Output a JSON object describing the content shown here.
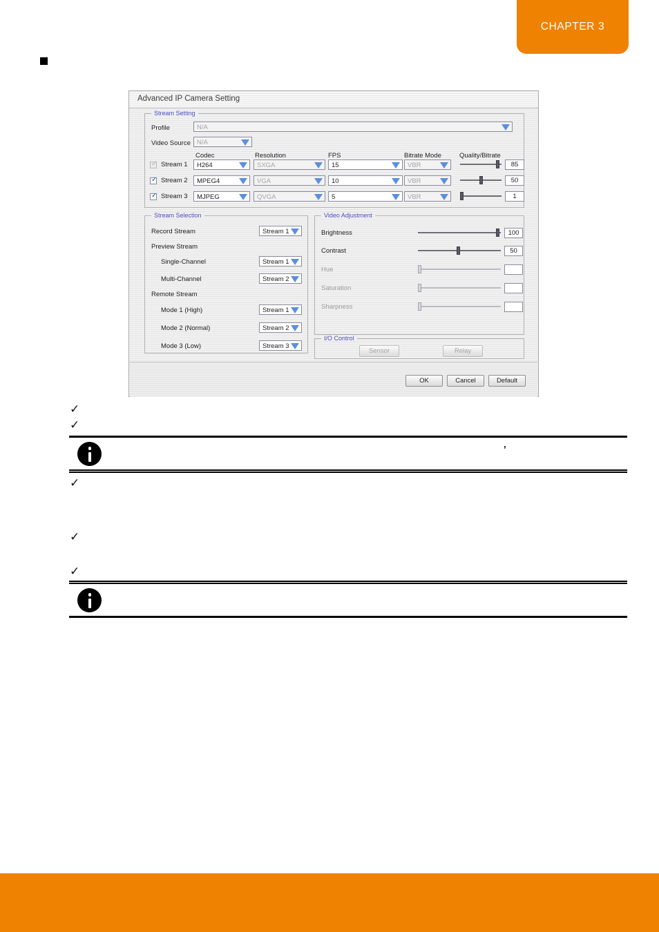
{
  "page": {
    "chapter_label": "CHAPTER 3",
    "accent_color": "#ef8200",
    "stray_comma": ","
  },
  "dialog": {
    "title": "Advanced IP Camera Setting",
    "stream_setting": {
      "legend": "Stream Setting",
      "profile_label": "Profile",
      "profile_value": "N/A",
      "video_source_label": "Video Source",
      "video_source_value": "N/A",
      "columns": {
        "codec": "Codec",
        "resolution": "Resolution",
        "fps": "FPS",
        "bitrate_mode": "Bitrate Mode",
        "quality_bitrate": "Quality/Bitrate"
      },
      "rows": [
        {
          "label": "Stream 1",
          "enabled": "checked-disabled",
          "codec": "H264",
          "resolution": "SXGA",
          "fps": "15",
          "bitrate_mode": "VBR",
          "quality": "85"
        },
        {
          "label": "Stream 2",
          "enabled": "checked",
          "codec": "MPEG4",
          "resolution": "VGA",
          "fps": "10",
          "bitrate_mode": "VBR",
          "quality": "50"
        },
        {
          "label": "Stream 3",
          "enabled": "checked",
          "codec": "MJPEG",
          "resolution": "QVGA",
          "fps": "5",
          "bitrate_mode": "VBR",
          "quality": "1"
        }
      ]
    },
    "stream_selection": {
      "legend": "Stream Selection",
      "record_stream_label": "Record Stream",
      "record_stream_value": "Stream 1",
      "preview_stream_label": "Preview Stream",
      "single_channel_label": "Single-Channel",
      "single_channel_value": "Stream 1",
      "multi_channel_label": "Multi-Channel",
      "multi_channel_value": "Stream 2",
      "remote_stream_label": "Remote Stream",
      "mode1_label": "Mode 1 (High)",
      "mode1_value": "Stream 1",
      "mode2_label": "Mode 2 (Normal)",
      "mode2_value": "Stream 2",
      "mode3_label": "Mode 3 (Low)",
      "mode3_value": "Stream 3"
    },
    "video_adjustment": {
      "legend": "Video Adjustment",
      "items": [
        {
          "label": "Brightness",
          "value": "100",
          "enabled": true
        },
        {
          "label": "Contrast",
          "value": "50",
          "enabled": true
        },
        {
          "label": "Hue",
          "value": "",
          "enabled": false
        },
        {
          "label": "Saturation",
          "value": "",
          "enabled": false
        },
        {
          "label": "Sharpness",
          "value": "",
          "enabled": false
        }
      ]
    },
    "io_control": {
      "legend": "I/O Control",
      "sensor_label": "Sensor",
      "relay_label": "Relay"
    },
    "buttons": {
      "ok": "OK",
      "cancel": "Cancel",
      "default": "Default"
    }
  },
  "body_markers": {
    "check_glyph": "✓",
    "bullets": [
      "",
      "",
      "",
      "",
      ""
    ],
    "notes": [
      {
        "icon": "info-icon",
        "text": ""
      },
      {
        "icon": "info-icon",
        "text": ""
      }
    ]
  }
}
